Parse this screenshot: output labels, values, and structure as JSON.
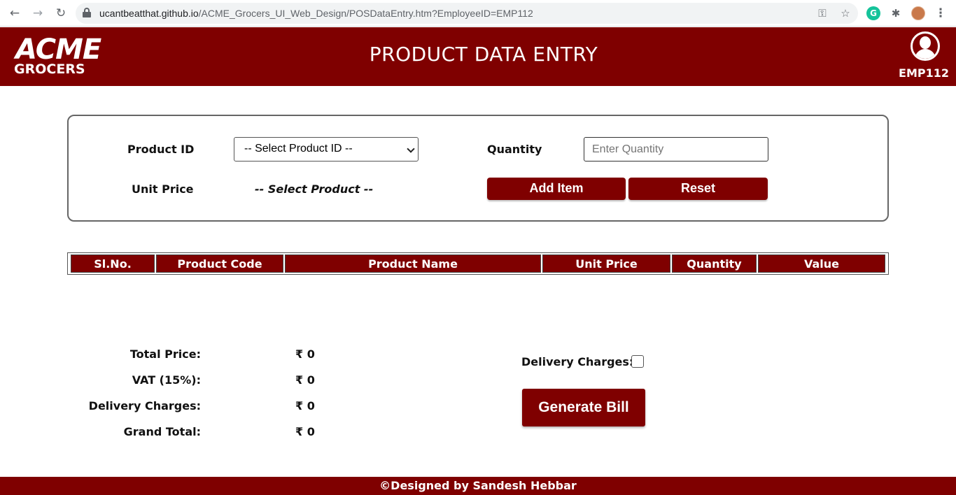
{
  "browser": {
    "url_host": "ucantbeatthat.github.io",
    "url_path": "/ACME_Grocers_UI_Web_Design/POSDataEntry.htm?EmployeeID=EMP112",
    "back_icon": "←",
    "forward_icon": "→",
    "reload_icon": "↻",
    "key_icon": "⚿",
    "star_icon": "☆",
    "puzzle_icon": "✱",
    "menu_icon": "⋮",
    "grammarly_label": "G"
  },
  "header": {
    "logo_line1": "ACME",
    "logo_line2": "GROCERS",
    "title": "PRODUCT DATA ENTRY",
    "employee_id": "EMP112"
  },
  "form": {
    "product_id_label": "Product ID",
    "product_select_value": "-- Select Product ID --",
    "quantity_label": "Quantity",
    "quantity_placeholder": "Enter Quantity",
    "unit_price_label": "Unit Price",
    "unit_price_value": "-- Select Product --",
    "add_item_label": "Add Item",
    "reset_label": "Reset"
  },
  "table": {
    "columns": [
      "Sl.No.",
      "Product Code",
      "Product Name",
      "Unit Price",
      "Quantity",
      "Value"
    ]
  },
  "totals": {
    "rows": [
      {
        "label": "Total Price:",
        "value": "₹ 0"
      },
      {
        "label": "VAT (15%):",
        "value": "₹ 0"
      },
      {
        "label": "Delivery Charges:",
        "value": "₹ 0"
      },
      {
        "label": "Grand Total:",
        "value": "₹ 0"
      }
    ],
    "delivery_checkbox_label": "Delivery Charges:",
    "delivery_checked": false,
    "generate_bill_label": "Generate Bill"
  },
  "footer": {
    "text": "©Designed by Sandesh Hebbar"
  },
  "colors": {
    "brand": "#7f0000"
  }
}
